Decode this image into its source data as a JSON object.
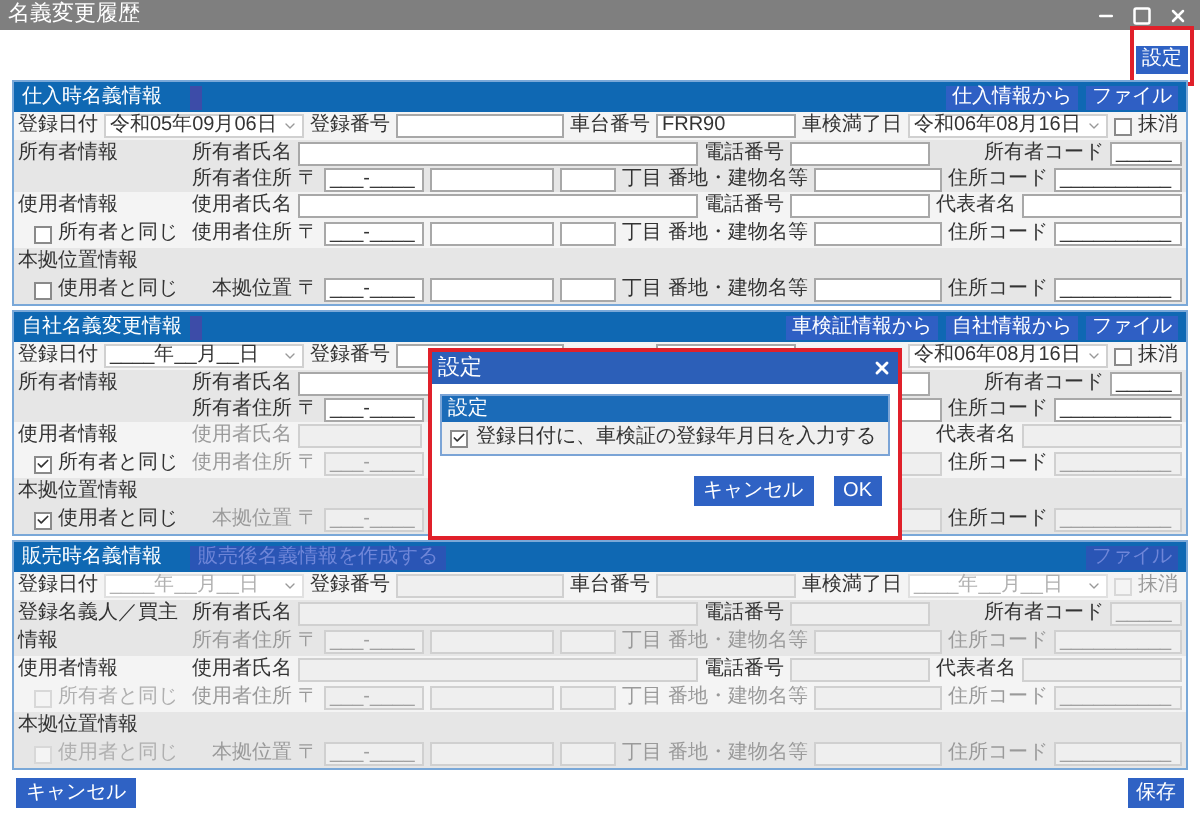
{
  "window": {
    "title": "名義変更履歴"
  },
  "settings_button": "設定",
  "sections": [
    {
      "title": "仕入時名義情報",
      "title_button": {
        "disabled": false
      },
      "header_buttons": [
        {
          "label": "仕入情報から",
          "disabled": false
        },
        {
          "label": "ファイル",
          "disabled": false
        }
      ],
      "disabled": false,
      "row1": {
        "reg_date_label": "登録日付",
        "reg_date": "令和05年09月06日",
        "reg_no_label": "登録番号",
        "chassis_label": "車台番号",
        "chassis": "FRR90",
        "inspection_label": "車検満了日",
        "inspection_date": "令和06年08月16日",
        "cancel_label": "抹消",
        "cancel_checked": false
      },
      "owner": {
        "group_label": "所有者情報",
        "name_label": "所有者氏名",
        "phone_label": "電話番号",
        "code_label": "所有者コード",
        "code": "_____",
        "addr_label": "所有者住所",
        "postal_mark": "〒",
        "zip": "___-____",
        "chome_label": "丁目",
        "banchi_label": "番地・建物名等",
        "addr_code_label": "住所コード",
        "addr_code": "__________",
        "disabled": false
      },
      "user": {
        "group_label": "使用者情報",
        "same_label": "所有者と同じ",
        "same_checked": false,
        "name_label": "使用者氏名",
        "phone_label": "電話番号",
        "rep_label": "代表者名",
        "addr_label": "使用者住所",
        "postal_mark": "〒",
        "zip": "___-____",
        "chome_label": "丁目",
        "banchi_label": "番地・建物名等",
        "addr_code_label": "住所コード",
        "addr_code": "__________",
        "disabled": false
      },
      "base": {
        "group_label": "本拠位置情報",
        "same_label": "使用者と同じ",
        "same_checked": false,
        "addr_label": "本拠位置",
        "postal_mark": "〒",
        "zip": "___-____",
        "chome_label": "丁目",
        "banchi_label": "番地・建物名等",
        "addr_code_label": "住所コード",
        "addr_code": "__________",
        "disabled": false
      }
    },
    {
      "title": "自社名義変更情報",
      "title_button": {
        "disabled": false
      },
      "header_buttons": [
        {
          "label": "車検証情報から",
          "disabled": false
        },
        {
          "label": "自社情報から",
          "disabled": false
        },
        {
          "label": "ファイル",
          "disabled": false
        }
      ],
      "disabled": false,
      "row1": {
        "reg_date_label": "登録日付",
        "reg_date": "____年__月__日",
        "reg_no_label": "登録番号",
        "inspection_date": "令和06年08月16日",
        "cancel_label": "抹消",
        "cancel_checked": false
      },
      "owner": {
        "group_label": "所有者情報",
        "name_label": "所有者氏名",
        "code_label": "所有者コード",
        "code": "_____",
        "addr_label": "所有者住所",
        "postal_mark": "〒",
        "zip": "___-____",
        "addr_code_label": "住所コード",
        "addr_code": "__________",
        "disabled": false
      },
      "user": {
        "group_label": "使用者情報",
        "same_label": "所有者と同じ",
        "same_checked": true,
        "name_label": "使用者氏名",
        "rep_label": "代表者名",
        "addr_label": "使用者住所",
        "postal_mark": "〒",
        "zip": "___-____",
        "addr_code_label": "住所コード",
        "addr_code": "__________",
        "disabled": true
      },
      "base": {
        "group_label": "本拠位置情報",
        "same_label": "使用者と同じ",
        "same_checked": true,
        "addr_label": "本拠位置",
        "postal_mark": "〒",
        "zip": "___-____",
        "addr_code_label": "住所コード",
        "addr_code": "__________",
        "disabled": true
      }
    },
    {
      "title": "販売時名義情報",
      "title_button": {
        "label": "販売後名義情報を作成する",
        "disabled": true
      },
      "header_buttons": [
        {
          "label": "ファイル",
          "disabled": true
        }
      ],
      "disabled": true,
      "row1": {
        "reg_date_label": "登録日付",
        "reg_date": "____年__月__日",
        "reg_no_label": "登録番号",
        "chassis_label": "車台番号",
        "inspection_label": "車検満了日",
        "inspection_date": "____年__月__日",
        "cancel_label": "抹消",
        "cancel_checked": false
      },
      "owner": {
        "group_label": "登録名義人／買主情報",
        "name_label": "所有者氏名",
        "phone_label": "電話番号",
        "code_label": "所有者コード",
        "code": "_____",
        "addr_label": "所有者住所",
        "postal_mark": "〒",
        "zip": "___-____",
        "chome_label": "丁目",
        "banchi_label": "番地・建物名等",
        "addr_code_label": "住所コード",
        "addr_code": "__________"
      },
      "user": {
        "group_label": "使用者情報",
        "same_label": "所有者と同じ",
        "same_checked": false,
        "name_label": "使用者氏名",
        "phone_label": "電話番号",
        "rep_label": "代表者名",
        "addr_label": "使用者住所",
        "postal_mark": "〒",
        "zip": "___-____",
        "chome_label": "丁目",
        "banchi_label": "番地・建物名等",
        "addr_code_label": "住所コード",
        "addr_code": "__________"
      },
      "base": {
        "group_label": "本拠位置情報",
        "same_label": "使用者と同じ",
        "same_checked": false,
        "addr_label": "本拠位置",
        "postal_mark": "〒",
        "zip": "___-____",
        "chome_label": "丁目",
        "banchi_label": "番地・建物名等",
        "addr_code_label": "住所コード",
        "addr_code": "__________"
      }
    }
  ],
  "dialog": {
    "title": "設定",
    "group_title": "設定",
    "option": {
      "label": "登録日付に、車検証の登録年月日を入力する",
      "checked": true
    },
    "buttons": [
      "キャンセル",
      "OK"
    ]
  },
  "footer": {
    "cancel": "キャンセル",
    "save": "保存"
  }
}
